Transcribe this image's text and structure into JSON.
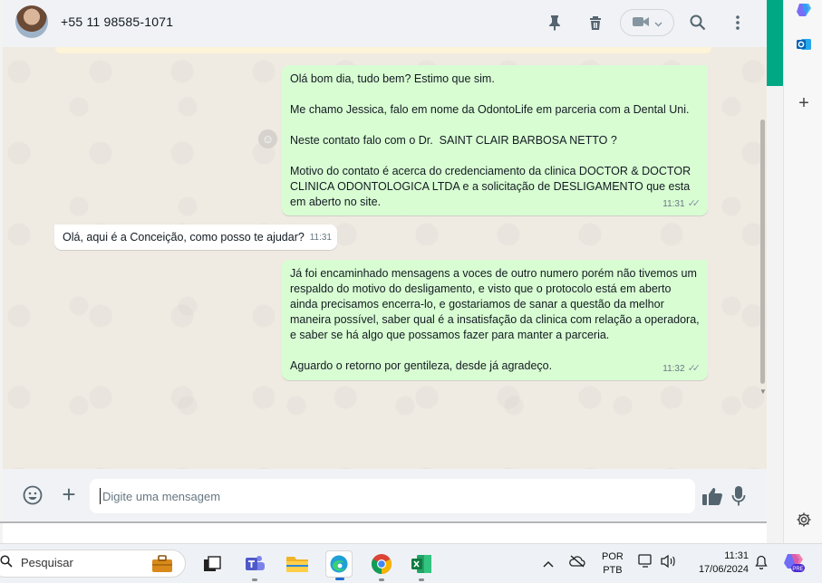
{
  "header": {
    "contact_name": "+55 11 98585-1071",
    "icons": [
      "pin-icon",
      "trash-icon",
      "video-call-icon",
      "search-icon",
      "more-options-icon"
    ]
  },
  "messages": [
    {
      "direction": "outgoing",
      "paragraphs": [
        "Olá bom dia, tudo bem? Estimo que sim.",
        "Me chamo Jessica, falo em nome da OdontoLife em parceria com a Dental Uni.",
        "Neste contato falo com o Dr.  SAINT CLAIR BARBOSA NETTO ?",
        "Motivo do contato é acerca do credenciamento da clinica DOCTOR & DOCTOR CLINICA ODONTOLOGICA LTDA e a solicitação de DESLIGAMENTO que esta em aberto no site."
      ],
      "time": "11:31",
      "status": "read-ticks"
    },
    {
      "direction": "incoming",
      "paragraphs": [
        "Olá, aqui é a Conceição, como posso te ajudar?"
      ],
      "time": "11:31"
    },
    {
      "direction": "outgoing",
      "paragraphs": [
        "Já foi encaminhado mensagens a voces de outro numero porém não tivemos um respaldo do motivo do desligamento, e visto que o protocolo está em aberto ainda precisamos encerra-lo, e gostariamos de sanar a questão da melhor maneira possível, saber qual é a insatisfação da clinica com relação a operadora, e saber se há algo que possamos fazer para manter a parceria.",
        "Aguardo o retorno por gentileza, desde já agradeço."
      ],
      "time": "11:32",
      "status": "read-ticks"
    }
  ],
  "composer": {
    "placeholder": "Digite uma mensagem"
  },
  "taskbar": {
    "search_label": "Pesquisar",
    "apps": [
      "toolbox-app",
      "task-view",
      "teams",
      "file-explorer",
      "edge",
      "chrome",
      "excel"
    ],
    "language": "POR",
    "keyboard": "PTB",
    "time": "11:31",
    "date": "17/06/2024"
  },
  "colors": {
    "outgoing_bubble": "#d9fdd3",
    "incoming_bubble": "#ffffff",
    "chat_background": "#efeae2",
    "accent": "#00a884"
  }
}
